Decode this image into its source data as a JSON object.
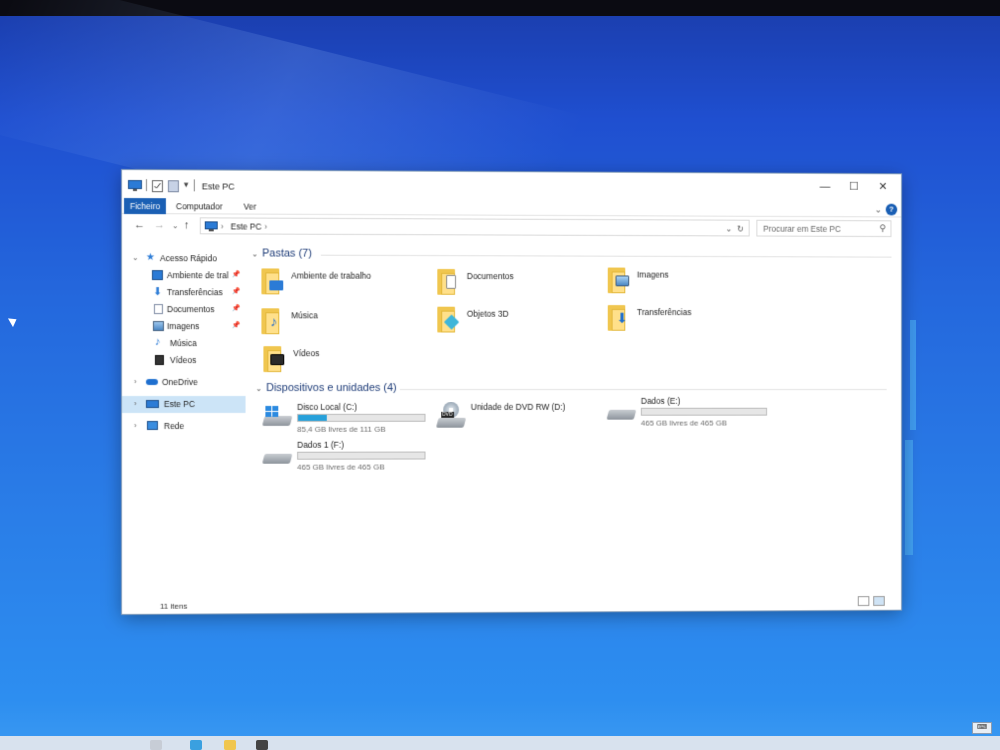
{
  "window": {
    "title": "Este PC",
    "controls": {
      "minimize": "—",
      "maximize": "☐",
      "close": "✕"
    }
  },
  "ribbon": {
    "tabs": [
      {
        "label": "Ficheiro",
        "active": true
      },
      {
        "label": "Computador",
        "active": false
      },
      {
        "label": "Ver",
        "active": false
      }
    ],
    "help": "?"
  },
  "navigation": {
    "path": [
      "Este PC"
    ],
    "search_placeholder": "Procurar em Este PC"
  },
  "sidebar": {
    "quick_access": {
      "label": "Acesso Rápido",
      "items": [
        {
          "label": "Ambiente de tral",
          "icon": "desktop-icon",
          "pinned": true
        },
        {
          "label": "Transferências",
          "icon": "download-icon",
          "pinned": true
        },
        {
          "label": "Documentos",
          "icon": "document-icon",
          "pinned": true
        },
        {
          "label": "Imagens",
          "icon": "pictures-icon",
          "pinned": true
        },
        {
          "label": "Música",
          "icon": "music-icon",
          "pinned": false
        },
        {
          "label": "Vídeos",
          "icon": "video-icon",
          "pinned": false
        }
      ]
    },
    "onedrive": "OneDrive",
    "this_pc": "Este PC",
    "network": "Rede"
  },
  "folders": {
    "header": "Pastas (7)",
    "items": [
      {
        "label": "Ambiente de trabalho",
        "icon": "desktop-folder-icon"
      },
      {
        "label": "Documentos",
        "icon": "documents-folder-icon"
      },
      {
        "label": "Imagens",
        "icon": "pictures-folder-icon"
      },
      {
        "label": "Música",
        "icon": "music-folder-icon"
      },
      {
        "label": "Objetos 3D",
        "icon": "3d-objects-folder-icon"
      },
      {
        "label": "Transferências",
        "icon": "downloads-folder-icon"
      },
      {
        "label": "Vídeos",
        "icon": "videos-folder-icon"
      }
    ]
  },
  "devices": {
    "header": "Dispositivos e unidades (4)",
    "items": [
      {
        "name": "Disco Local (C:)",
        "free": "85,4 GB livres de 111 GB",
        "used_fraction": 0.23,
        "icon": "windows-drive-icon"
      },
      {
        "name": "Unidade de DVD RW (D:)",
        "free": "",
        "icon": "dvd-drive-icon"
      },
      {
        "name": "Dados (E:)",
        "free": "465 GB livres de 465 GB",
        "used_fraction": 0.0,
        "icon": "hard-drive-icon"
      },
      {
        "name": "Dados 1 (F:)",
        "free": "465 GB livres de 465 GB",
        "used_fraction": 0.0,
        "icon": "hard-drive-icon"
      }
    ]
  },
  "status": {
    "item_count": "11 itens"
  }
}
